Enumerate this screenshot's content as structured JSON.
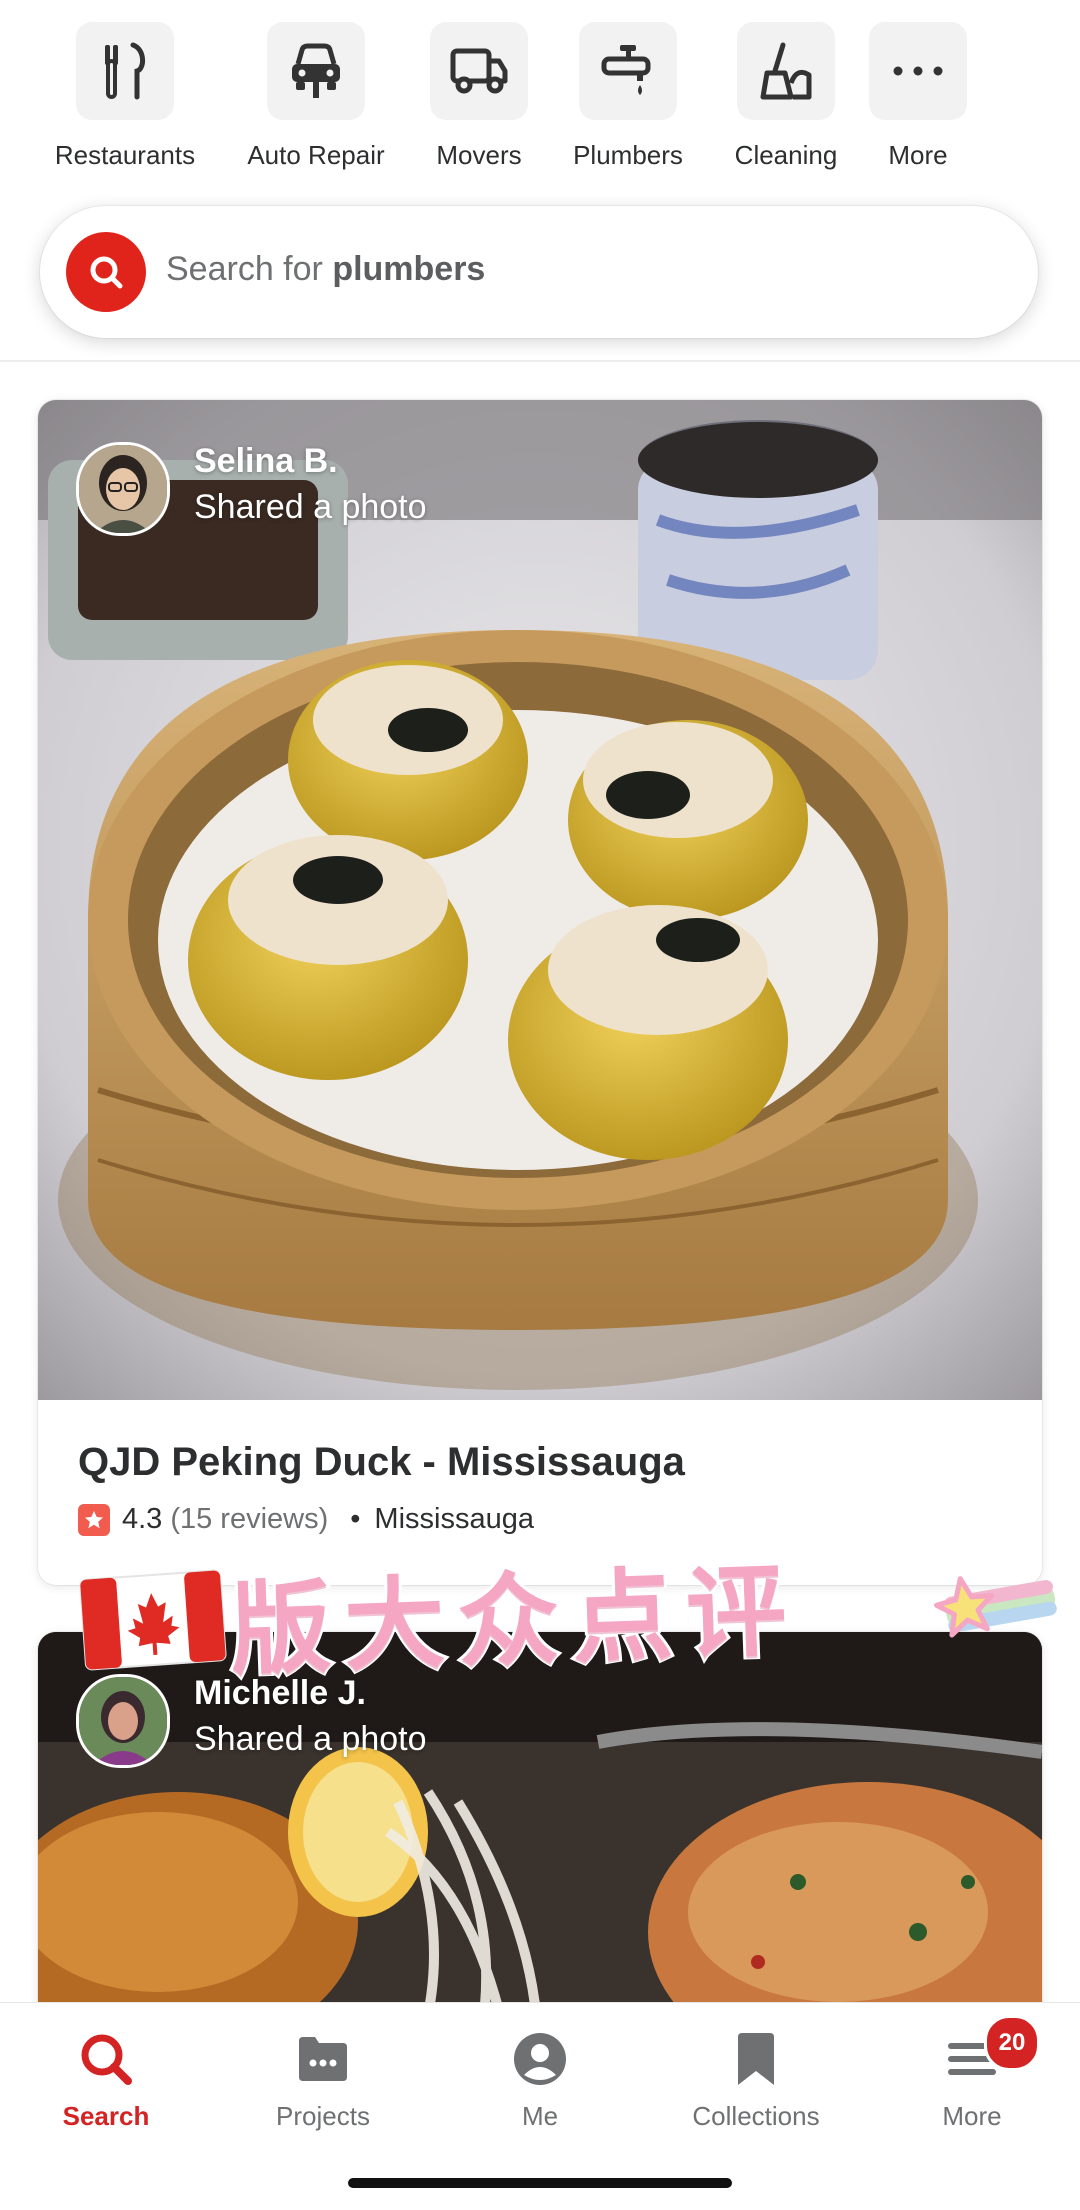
{
  "categories": [
    {
      "label": "Restaurants",
      "icon": "fork-knife-icon"
    },
    {
      "label": "Auto Repair",
      "icon": "car-icon"
    },
    {
      "label": "Movers",
      "icon": "truck-icon"
    },
    {
      "label": "Plumbers",
      "icon": "faucet-icon"
    },
    {
      "label": "Cleaning",
      "icon": "cleaning-icon"
    },
    {
      "label": "More",
      "icon": "more-dots-icon"
    }
  ],
  "search": {
    "prefix": "Search for ",
    "term": "plumbers"
  },
  "feed": [
    {
      "user_name": "Selina B.",
      "action": "Shared a photo",
      "business_name": "QJD Peking Duck - Mississauga",
      "rating": "4.3",
      "reviews": "(15 reviews)",
      "separator": "•",
      "location": "Mississauga"
    },
    {
      "user_name": "Michelle J.",
      "action": "Shared a photo"
    }
  ],
  "banner": {
    "text": "版大众点评"
  },
  "tabbar": [
    {
      "label": "Search",
      "icon": "search-icon",
      "active": true
    },
    {
      "label": "Projects",
      "icon": "projects-icon"
    },
    {
      "label": "Me",
      "icon": "profile-icon"
    },
    {
      "label": "Collections",
      "icon": "bookmark-icon"
    },
    {
      "label": "More",
      "icon": "menu-icon",
      "badge": "20"
    }
  ],
  "colors": {
    "brand_red": "#d32323",
    "search_red": "#e0241b",
    "star_orange": "#f15c4f",
    "banner_pink": "#f4a6c3"
  }
}
